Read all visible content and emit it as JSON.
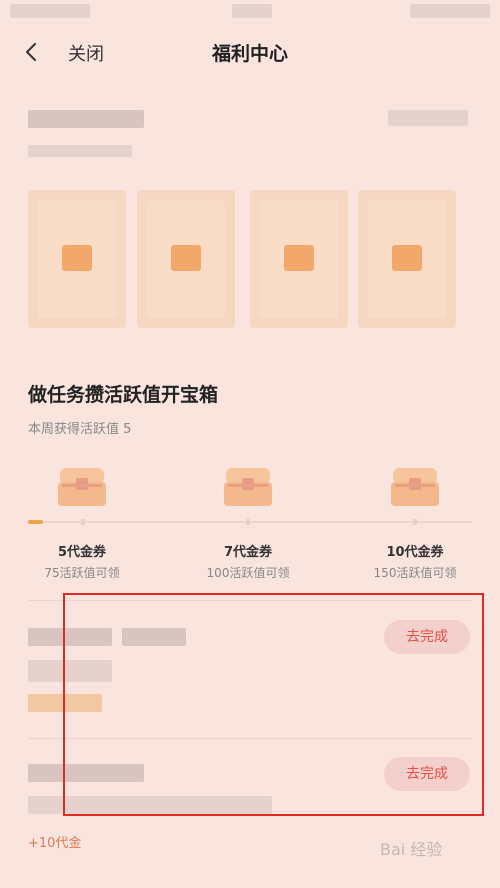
{
  "nav": {
    "close_label": "关闭",
    "title": "福利中心"
  },
  "tasks_section": {
    "title": "做任务攒活跃值开宝箱",
    "weekly_text": "本周获得活跃值 5",
    "progress_fraction": 0.033,
    "rewards": [
      {
        "label": "5代金券",
        "requirement": "75活跃值可领"
      },
      {
        "label": "7代金券",
        "requirement": "100活跃值可领"
      },
      {
        "label": "10代金券",
        "requirement": "150活跃值可领"
      }
    ],
    "tasks": [
      {
        "button_label": "去完成"
      },
      {
        "button_label": "去完成",
        "reward_text": "+10代金"
      }
    ]
  },
  "watermark": "Bai 经验",
  "colors": {
    "background": "#f9e4de",
    "accent": "#e0524a",
    "progress": "#f0a248",
    "highlight": "#e02a2a"
  }
}
